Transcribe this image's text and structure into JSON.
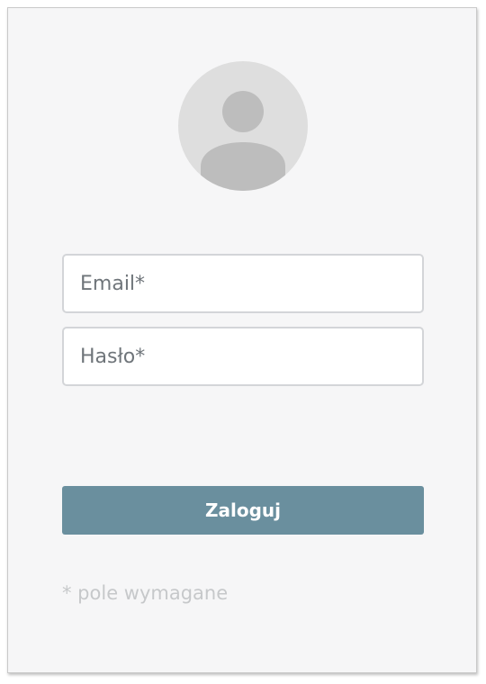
{
  "avatar": {
    "icon": "user-avatar-icon"
  },
  "form": {
    "email_placeholder": "Email*",
    "password_placeholder": "Hasło*",
    "login_label": "Zaloguj",
    "required_note": "* pole wymagane"
  },
  "colors": {
    "card_background": "#f6f6f7",
    "button_background": "#6a8f9e",
    "button_text": "#ffffff",
    "note_text": "#c6c8ca",
    "avatar_background": "#dedede",
    "avatar_figure": "#bdbdbd"
  }
}
